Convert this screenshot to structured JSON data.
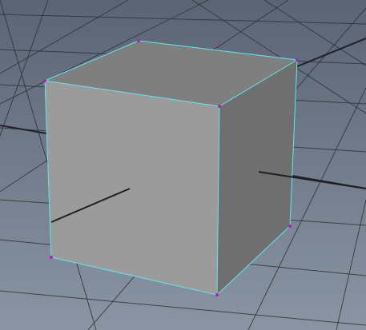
{
  "viewport": {
    "background_top": "#5a6474",
    "background_bottom": "#8a95a4",
    "grid_color": "#2f3338",
    "axis_color": "#1e2024"
  },
  "cube": {
    "selected": true,
    "selection_color": "#5fe8ea",
    "vertex_color": "#b21fb9",
    "face_colors": {
      "front": "#9b9b9b",
      "top": "#7f7f7f",
      "right": "#6f6f6f"
    },
    "vertex_count": 7
  }
}
